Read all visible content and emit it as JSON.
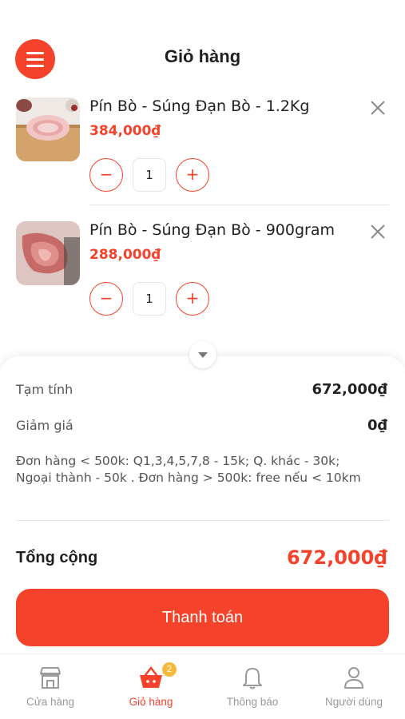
{
  "header": {
    "title": "Giỏ hàng",
    "menu_icon": "hamburger-icon"
  },
  "cart_items": [
    {
      "name": "Pín Bò - Súng Đạn Bò - 1.2Kg",
      "price": "384,000₫",
      "quantity": "1"
    },
    {
      "name": "Pín Bò - Súng Đạn Bò - 900gram",
      "price": "288,000₫",
      "quantity": "1"
    }
  ],
  "summary": {
    "subtotal_label": "Tạm tính",
    "subtotal_value": "672,000₫",
    "discount_label": "Giảm giá",
    "discount_value": "0₫",
    "shipping_note": "Đơn hàng < 500k: Q1,3,4,5,7,8 - 15k; Q. khác - 30k; Ngoại thành - 50k . Đơn hàng > 500k: free nếu < 10km",
    "total_label": "Tổng cộng",
    "total_value": "672,000₫",
    "checkout_label": "Thanh toán"
  },
  "bottom_nav": {
    "items": [
      {
        "label": "Cửa hàng",
        "icon": "store-icon",
        "active": false
      },
      {
        "label": "Giỏ hàng",
        "icon": "basket-icon",
        "active": true,
        "badge": "2"
      },
      {
        "label": "Thông báo",
        "icon": "bell-icon",
        "active": false
      },
      {
        "label": "Người dùng",
        "icon": "user-icon",
        "active": false
      }
    ]
  },
  "colors": {
    "accent": "#f5432b",
    "badge": "#f7b93a",
    "inactive": "#9a9a9a"
  }
}
